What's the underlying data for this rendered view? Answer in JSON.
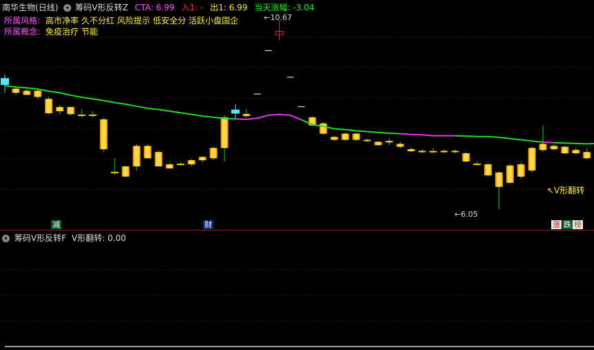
{
  "header": {
    "stock_name": "南华生物(日线)",
    "indicator_name": "筹码V形反转Z",
    "cta_label": "CTA: 6.99",
    "entry_label": "入1: -",
    "exit_label": "出1: 6.99",
    "change_label": "当天涨幅: -3.04"
  },
  "info": {
    "style_label": "所属风格:",
    "style_value": "高市净率 久不分红 风险提示 低安全分 活跃小盘国企",
    "concept_label": "所属概念:",
    "concept_value": "免疫治疗 节能"
  },
  "annotations": {
    "high_value": "10.67",
    "low_value": "6.05",
    "signal_label": "V形翻转"
  },
  "markers": {
    "jian": "减",
    "cai": "财",
    "zhang": "涨",
    "die": "跌",
    "bang": "榜"
  },
  "sub_header": {
    "indicator_name": "筹码V形反转F",
    "value_label": "V形翻转: 0.00"
  },
  "colors": {
    "up": "#ffcc00",
    "down": "#ffd700",
    "cyan": "#55e6ff",
    "red": "#ff2020",
    "ma_green": "#22dd22",
    "ma_magenta": "#ee33ee",
    "text_yellow": "#ffee44",
    "text_magenta": "#ff55ff"
  },
  "icons": {
    "dropdown": "dropdown-circle-icon",
    "arrow": "pointer-arrow-icon"
  },
  "chart_data": {
    "type": "candlestick",
    "title": "筹码V形反转Z",
    "ylim": [
      5.8,
      11.0
    ],
    "candles": [
      {
        "o": 9.1,
        "h": 9.35,
        "l": 8.9,
        "c": 9.25,
        "cat": "cyan"
      },
      {
        "o": 9.0,
        "h": 9.05,
        "l": 8.85,
        "c": 8.9,
        "cat": "yel"
      },
      {
        "o": 8.95,
        "h": 9.0,
        "l": 8.85,
        "c": 8.85,
        "cat": "yel"
      },
      {
        "o": 8.95,
        "h": 9.0,
        "l": 8.75,
        "c": 8.8,
        "cat": "yel"
      },
      {
        "o": 8.75,
        "h": 8.8,
        "l": 8.38,
        "c": 8.4,
        "cat": "yel"
      },
      {
        "o": 8.55,
        "h": 8.6,
        "l": 8.38,
        "c": 8.45,
        "cat": "yel"
      },
      {
        "o": 8.55,
        "h": 8.55,
        "l": 8.35,
        "c": 8.38,
        "cat": "yel"
      },
      {
        "o": 8.35,
        "h": 8.5,
        "l": 8.3,
        "c": 8.35,
        "cat": "flat"
      },
      {
        "o": 8.35,
        "h": 8.45,
        "l": 8.3,
        "c": 8.35,
        "cat": "flat"
      },
      {
        "o": 8.25,
        "h": 8.28,
        "l": 7.45,
        "c": 7.52,
        "cat": "yel"
      },
      {
        "o": 6.95,
        "h": 7.3,
        "l": 6.9,
        "c": 6.95,
        "cat": "flat"
      },
      {
        "o": 7.1,
        "h": 7.12,
        "l": 6.85,
        "c": 6.85,
        "cat": "yel"
      },
      {
        "o": 7.1,
        "h": 7.65,
        "l": 7.0,
        "c": 7.6,
        "cat": "yel"
      },
      {
        "o": 7.6,
        "h": 7.65,
        "l": 7.3,
        "c": 7.3,
        "cat": "yel"
      },
      {
        "o": 7.45,
        "h": 7.48,
        "l": 7.1,
        "c": 7.1,
        "cat": "yel"
      },
      {
        "o": 7.15,
        "h": 7.18,
        "l": 7.05,
        "c": 7.05,
        "cat": "yel"
      },
      {
        "o": 7.15,
        "h": 7.2,
        "l": 7.12,
        "c": 7.15,
        "cat": "flat"
      },
      {
        "o": 7.15,
        "h": 7.28,
        "l": 7.1,
        "c": 7.25,
        "cat": "yel"
      },
      {
        "o": 7.25,
        "h": 7.35,
        "l": 7.2,
        "c": 7.33,
        "cat": "yel"
      },
      {
        "o": 7.3,
        "h": 7.58,
        "l": 7.25,
        "c": 7.55,
        "cat": "yel"
      },
      {
        "o": 7.55,
        "h": 8.35,
        "l": 7.22,
        "c": 8.3,
        "cat": "yel"
      },
      {
        "o": 8.4,
        "h": 8.62,
        "l": 8.25,
        "c": 8.48,
        "cat": "cyan"
      },
      {
        "o": 8.38,
        "h": 8.5,
        "l": 8.3,
        "c": 8.33,
        "cat": "yel"
      },
      {
        "o": 8.85,
        "h": 8.9,
        "l": 8.85,
        "c": 8.87,
        "cat": "dash"
      },
      {
        "o": 9.92,
        "h": 9.95,
        "l": 9.92,
        "c": 9.93,
        "cat": "dash"
      },
      {
        "o": 10.4,
        "h": 10.67,
        "l": 10.2,
        "c": 10.32,
        "cat": "red"
      },
      {
        "o": 9.27,
        "h": 9.3,
        "l": 9.27,
        "c": 9.28,
        "cat": "dash"
      },
      {
        "o": 8.55,
        "h": 8.58,
        "l": 8.55,
        "c": 8.56,
        "cat": "dash"
      },
      {
        "o": 8.3,
        "h": 8.32,
        "l": 8.1,
        "c": 8.1,
        "cat": "yel"
      },
      {
        "o": 8.15,
        "h": 8.18,
        "l": 7.88,
        "c": 7.9,
        "cat": "yel"
      },
      {
        "o": 7.82,
        "h": 7.85,
        "l": 7.72,
        "c": 7.75,
        "cat": "yel"
      },
      {
        "o": 7.9,
        "h": 7.92,
        "l": 7.72,
        "c": 7.75,
        "cat": "yel"
      },
      {
        "o": 7.9,
        "h": 7.92,
        "l": 7.72,
        "c": 7.75,
        "cat": "yel"
      },
      {
        "o": 7.75,
        "h": 7.78,
        "l": 7.7,
        "c": 7.72,
        "cat": "yel"
      },
      {
        "o": 7.7,
        "h": 7.72,
        "l": 7.6,
        "c": 7.62,
        "cat": "yel"
      },
      {
        "o": 7.7,
        "h": 7.78,
        "l": 7.62,
        "c": 7.72,
        "cat": "yel"
      },
      {
        "o": 7.65,
        "h": 7.7,
        "l": 7.55,
        "c": 7.58,
        "cat": "yel"
      },
      {
        "o": 7.52,
        "h": 7.55,
        "l": 7.45,
        "c": 7.47,
        "cat": "yel"
      },
      {
        "o": 7.48,
        "h": 7.52,
        "l": 7.42,
        "c": 7.45,
        "cat": "yel"
      },
      {
        "o": 7.48,
        "h": 7.55,
        "l": 7.42,
        "c": 7.46,
        "cat": "flat"
      },
      {
        "o": 7.48,
        "h": 7.52,
        "l": 7.42,
        "c": 7.46,
        "cat": "yel"
      },
      {
        "o": 7.48,
        "h": 7.52,
        "l": 7.42,
        "c": 7.46,
        "cat": "yel"
      },
      {
        "o": 7.42,
        "h": 7.45,
        "l": 7.2,
        "c": 7.22,
        "cat": "yel"
      },
      {
        "o": 7.2,
        "h": 7.22,
        "l": 7.12,
        "c": 7.15,
        "cat": "flat"
      },
      {
        "o": 7.15,
        "h": 7.18,
        "l": 6.85,
        "c": 6.88,
        "cat": "yel"
      },
      {
        "o": 6.95,
        "h": 6.98,
        "l": 6.05,
        "c": 6.6,
        "cat": "yel"
      },
      {
        "o": 6.7,
        "h": 7.15,
        "l": 6.68,
        "c": 7.12,
        "cat": "yel"
      },
      {
        "o": 6.85,
        "h": 7.2,
        "l": 6.8,
        "c": 7.15,
        "cat": "yel"
      },
      {
        "o": 7.0,
        "h": 7.58,
        "l": 6.95,
        "c": 7.55,
        "cat": "yel"
      },
      {
        "o": 7.5,
        "h": 8.1,
        "l": 7.45,
        "c": 7.65,
        "cat": "yel"
      },
      {
        "o": 7.6,
        "h": 7.65,
        "l": 7.5,
        "c": 7.52,
        "cat": "yel"
      },
      {
        "o": 7.58,
        "h": 7.6,
        "l": 7.4,
        "c": 7.42,
        "cat": "yel"
      },
      {
        "o": 7.5,
        "h": 7.55,
        "l": 7.4,
        "c": 7.42,
        "cat": "yel"
      },
      {
        "o": 7.45,
        "h": 7.55,
        "l": 7.28,
        "c": 7.3,
        "cat": "yel"
      },
      {
        "o": 7.4,
        "h": 7.45,
        "l": 7.38,
        "c": 7.42,
        "cat": "flat"
      },
      {
        "o": 7.7,
        "h": 7.72,
        "l": 7.35,
        "c": 7.38,
        "cat": "redfill"
      },
      {
        "o": 7.75,
        "h": 8.4,
        "l": 7.72,
        "c": 8.15,
        "cat": "redout"
      },
      {
        "o": 7.9,
        "h": 8.12,
        "l": 7.82,
        "c": 8.1,
        "cat": "cyan"
      },
      {
        "o": 7.95,
        "h": 8.0,
        "l": 7.48,
        "c": 7.6,
        "cat": "redout"
      },
      {
        "o": 7.85,
        "h": 7.97,
        "l": 7.7,
        "c": 7.95,
        "cat": "cyan"
      },
      {
        "o": 7.68,
        "h": 7.72,
        "l": 7.58,
        "c": 7.6,
        "cat": "yel"
      }
    ],
    "ma_line": [
      9.07,
      9.04,
      9.02,
      8.99,
      8.94,
      8.9,
      8.84,
      8.79,
      8.75,
      8.71,
      8.66,
      8.62,
      8.57,
      8.52,
      8.49,
      8.45,
      8.41,
      8.37,
      8.33,
      8.3,
      8.27,
      8.26,
      8.25,
      8.28,
      8.35,
      8.37,
      8.35,
      8.24,
      8.12,
      8.08,
      8.02,
      8.0,
      7.97,
      7.95,
      7.93,
      7.91,
      7.9,
      7.88,
      7.87,
      7.85,
      7.85,
      7.85,
      7.84,
      7.83,
      7.83,
      7.81,
      7.78,
      7.75,
      7.72,
      7.69,
      7.68,
      7.67,
      7.66,
      7.65,
      7.66,
      7.67,
      7.67,
      7.68,
      7.69,
      7.69,
      7.63
    ],
    "ma_magenta_ranges": [
      [
        21,
        27
      ],
      [
        36,
        41
      ],
      [
        49,
        50
      ],
      [
        56,
        60
      ]
    ],
    "indicator": {
      "name": "V形翻转",
      "ylim": [
        0,
        1
      ],
      "values_nonzero": [
        {
          "index": 57,
          "value": 1
        }
      ],
      "last_value": 0.0
    }
  }
}
